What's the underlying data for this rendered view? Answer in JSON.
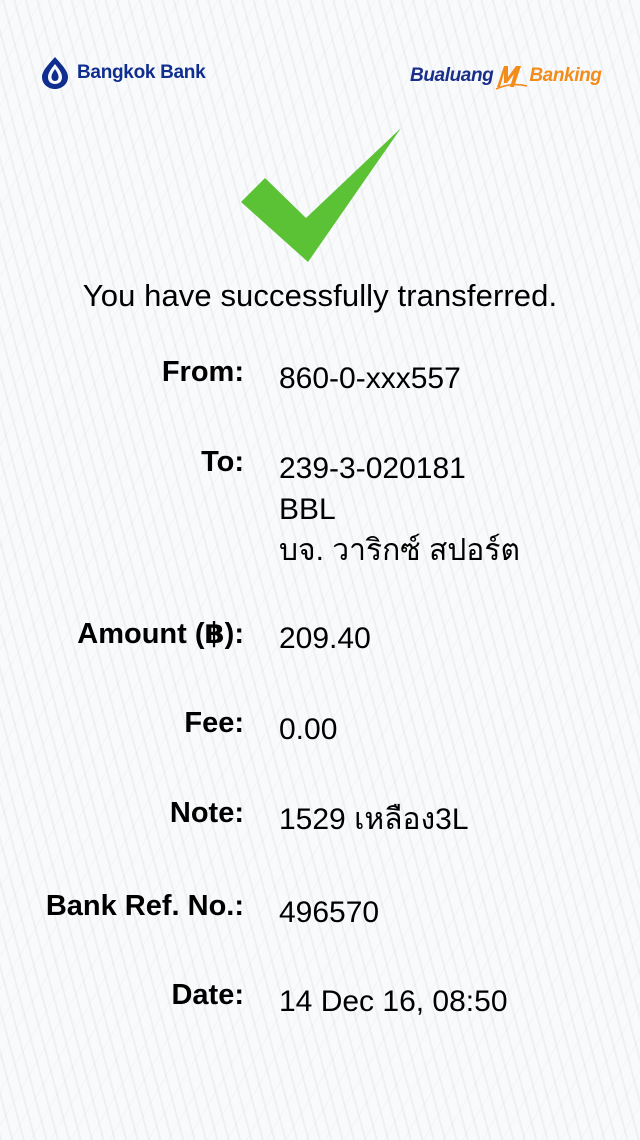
{
  "header": {
    "bank_name": "Bangkok Bank",
    "app_name_part1": "Bualuang",
    "app_name_part2": "Banking",
    "brand_color": "#0f2e8f",
    "accent_color": "#f28c1b"
  },
  "status": {
    "icon": "checkmark-icon",
    "color": "#5bc236",
    "message": "You have successfully transferred."
  },
  "details": {
    "from_label": "From:",
    "from_value": "860-0-xxx557",
    "to_label": "To:",
    "to_account": "239-3-020181",
    "to_bank": "BBL",
    "to_name": "บจ. วาริกซ์ สปอร์ต",
    "amount_label": "Amount (฿):",
    "amount_value": "209.40",
    "fee_label": "Fee:",
    "fee_value": "0.00",
    "note_label": "Note:",
    "note_value": "1529 เหลือง3L",
    "ref_label": "Bank Ref. No.:",
    "ref_value": "496570",
    "date_label": "Date:",
    "date_value": "14 Dec 16, 08:50"
  }
}
